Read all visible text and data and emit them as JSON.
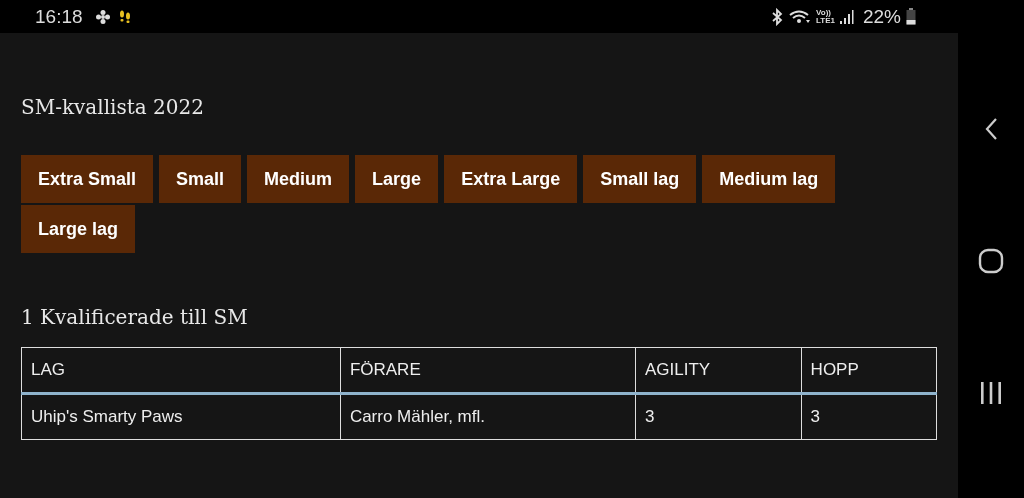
{
  "status_bar": {
    "time": "16:18",
    "network_top": "Vo))",
    "network_bottom": "LTE1",
    "battery": "22%"
  },
  "page": {
    "title": "SM-kvallista 2022",
    "tabs": [
      {
        "label": "Extra Small",
        "selected": false
      },
      {
        "label": "Small",
        "selected": false
      },
      {
        "label": "Medium",
        "selected": false
      },
      {
        "label": "Large",
        "selected": false
      },
      {
        "label": "Extra Large",
        "selected": false
      },
      {
        "label": "Small lag",
        "selected": false
      },
      {
        "label": "Medium lag",
        "selected": false
      },
      {
        "label": "Large lag",
        "selected": false
      }
    ],
    "section_title": "1 Kvalificerade till SM",
    "table": {
      "columns": [
        "LAG",
        "FÖRARE",
        "AGILITY",
        "HOPP"
      ],
      "rows": [
        [
          "Uhip's Smarty Paws",
          "Carro Mähler, mfl.",
          "3",
          "3"
        ]
      ]
    }
  }
}
